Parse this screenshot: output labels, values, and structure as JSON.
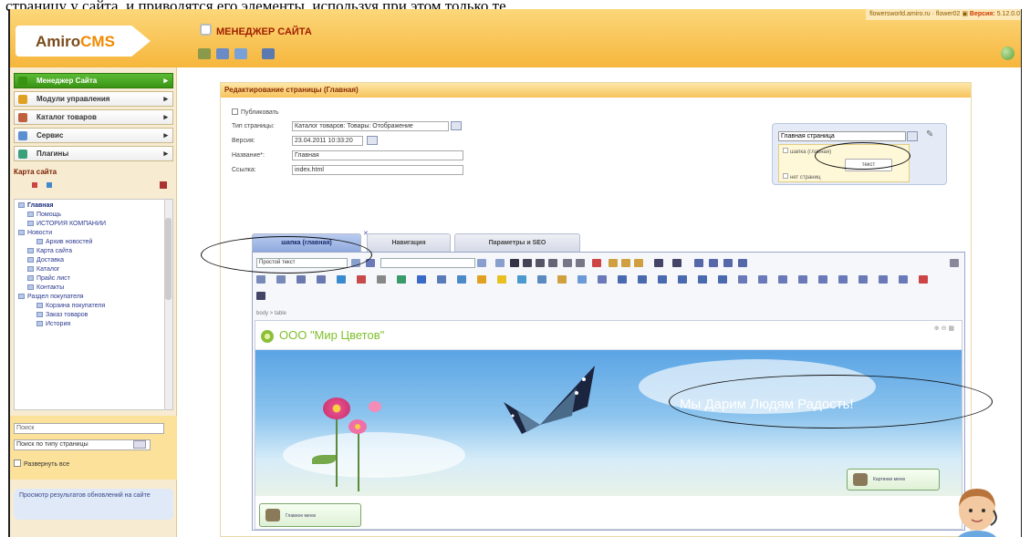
{
  "doc_line_text": "страницу у сайта, и приводятся его элементы, используя при этом только те",
  "top_info": {
    "site": "flowersworld.amiro.ru",
    "user": "flower02",
    "version_label": "Версия:",
    "version": "5.12.0.0"
  },
  "logo": {
    "part1": "Amiro",
    "part2": "CMS"
  },
  "manager_title": "МЕНЕДЖЕР САЙТА",
  "colors": {
    "accent": "#f6b63c",
    "green": "#5cbb35",
    "dark_red": "#a01f00",
    "tab_blue": "#8fa9de"
  },
  "sidebar": {
    "menu": [
      {
        "label": "Менеджер Сайта",
        "active": true,
        "icon": "site-manager-icon",
        "color": "#3a9414"
      },
      {
        "label": "Модули управления",
        "active": false,
        "icon": "modules-icon",
        "color": "#e0a020"
      },
      {
        "label": "Каталог товаров",
        "active": false,
        "icon": "catalog-icon",
        "color": "#c0603a"
      },
      {
        "label": "Сервис",
        "active": false,
        "icon": "service-icon",
        "color": "#5c8fd0"
      },
      {
        "label": "Плагины",
        "active": false,
        "icon": "plugins-icon",
        "color": "#3aa07a"
      }
    ],
    "map_title": "Карта сайта",
    "tree": [
      {
        "label": "Главная",
        "level": 0,
        "root": true
      },
      {
        "label": "Помощь",
        "level": 1
      },
      {
        "label": "ИСТОРИЯ КОМПАНИИ",
        "level": 1
      },
      {
        "label": "Новости",
        "level": 0
      },
      {
        "label": "Архив новостей",
        "level": 2
      },
      {
        "label": "Карта сайта",
        "level": 1
      },
      {
        "label": "Доставка",
        "level": 1
      },
      {
        "label": "Каталог",
        "level": 1
      },
      {
        "label": "Прайс лист",
        "level": 1
      },
      {
        "label": "Контакты",
        "level": 1
      },
      {
        "label": "Раздел покупателя",
        "level": 0
      },
      {
        "label": "Корзина покупателя",
        "level": 2
      },
      {
        "label": "Заказ товаров",
        "level": 2
      },
      {
        "label": "История",
        "level": 2
      }
    ],
    "search_placeholder": "Поиск",
    "search_scope": "Поиск по типу страницы",
    "expand_all": "Развернуть все",
    "note": "Просмотр результатов обновлений на сайте"
  },
  "main": {
    "header": "Редактирование страницы (Главная)",
    "publish_label": "Публиковать",
    "fields": [
      {
        "label": "Тип страницы:",
        "value": "Каталог товаров: Товары: Отображение"
      },
      {
        "label": "Версия:",
        "value": "23.04.2011 10:33:20"
      },
      {
        "label": "Название*:",
        "value": "Главная"
      },
      {
        "label": "Ссылка:",
        "value": "index.html"
      }
    ],
    "right_box": {
      "select_value": "Главная страница",
      "items": [
        "шапка (главная)",
        "нет страниц"
      ],
      "button": "текст"
    },
    "tabs": [
      "шапка (главная)",
      "Навигация",
      "Параметры и SEO"
    ],
    "editor": {
      "format_select": "Простой текст",
      "path": "body > table",
      "brand": "ООО \"Мир Цветов\"",
      "slogan": "Мы Дарим Людям Радость!",
      "banner_note": "Картинки меню",
      "main_note": "Главное меню"
    }
  }
}
